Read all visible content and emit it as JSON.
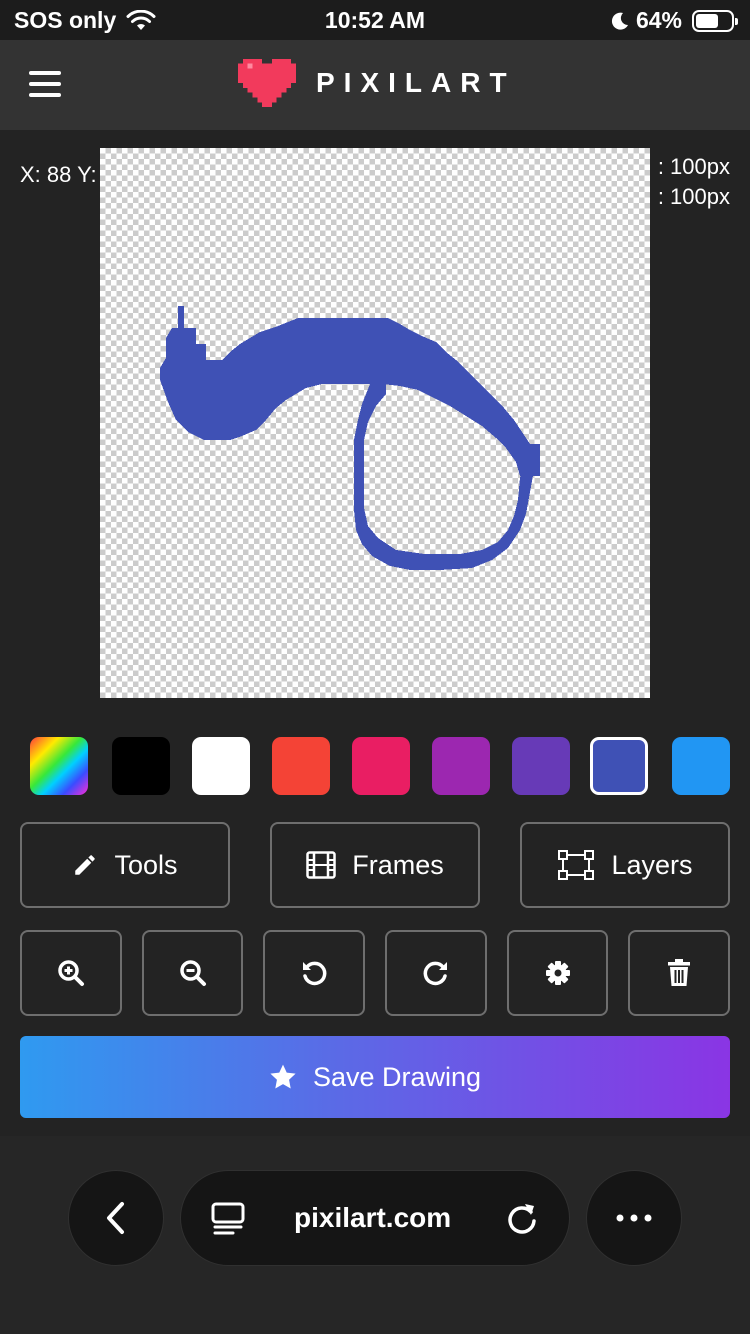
{
  "status_bar": {
    "carrier": "SOS only",
    "time": "10:52 AM",
    "battery": "64%",
    "icons": [
      "wifi-icon",
      "moon-icon",
      "battery-icon"
    ]
  },
  "header": {
    "logo_text": "PIXILART",
    "menu_icon": "hamburger-icon",
    "logo_icon": "pixel-heart-icon",
    "logo_color": "#f23a5c"
  },
  "canvas": {
    "coords_text": "X: 88 Y:",
    "width_text": ": 100px",
    "height_text": ": 100px",
    "stroke_color": "#3f51b5"
  },
  "palette": {
    "colors": [
      "rainbow",
      "#000000",
      "#ffffff",
      "#f44336",
      "#e91e63",
      "#9c27b0",
      "#673ab7",
      "#3f51b5",
      "#2196f3"
    ],
    "selected": "#3f51b5"
  },
  "tabs": {
    "tools_label": "Tools",
    "frames_label": "Frames",
    "layers_label": "Layers"
  },
  "actions": {
    "icons": [
      "zoom-in-icon",
      "zoom-out-icon",
      "undo-icon",
      "redo-icon",
      "settings-icon",
      "trash-icon"
    ]
  },
  "save": {
    "label": "Save Drawing",
    "gradient": [
      "#2f9af0",
      "#8a35e4"
    ]
  },
  "browser": {
    "url": "pixilart.com",
    "icons": [
      "back-icon",
      "tabs-icon",
      "reload-icon",
      "more-icon"
    ]
  }
}
